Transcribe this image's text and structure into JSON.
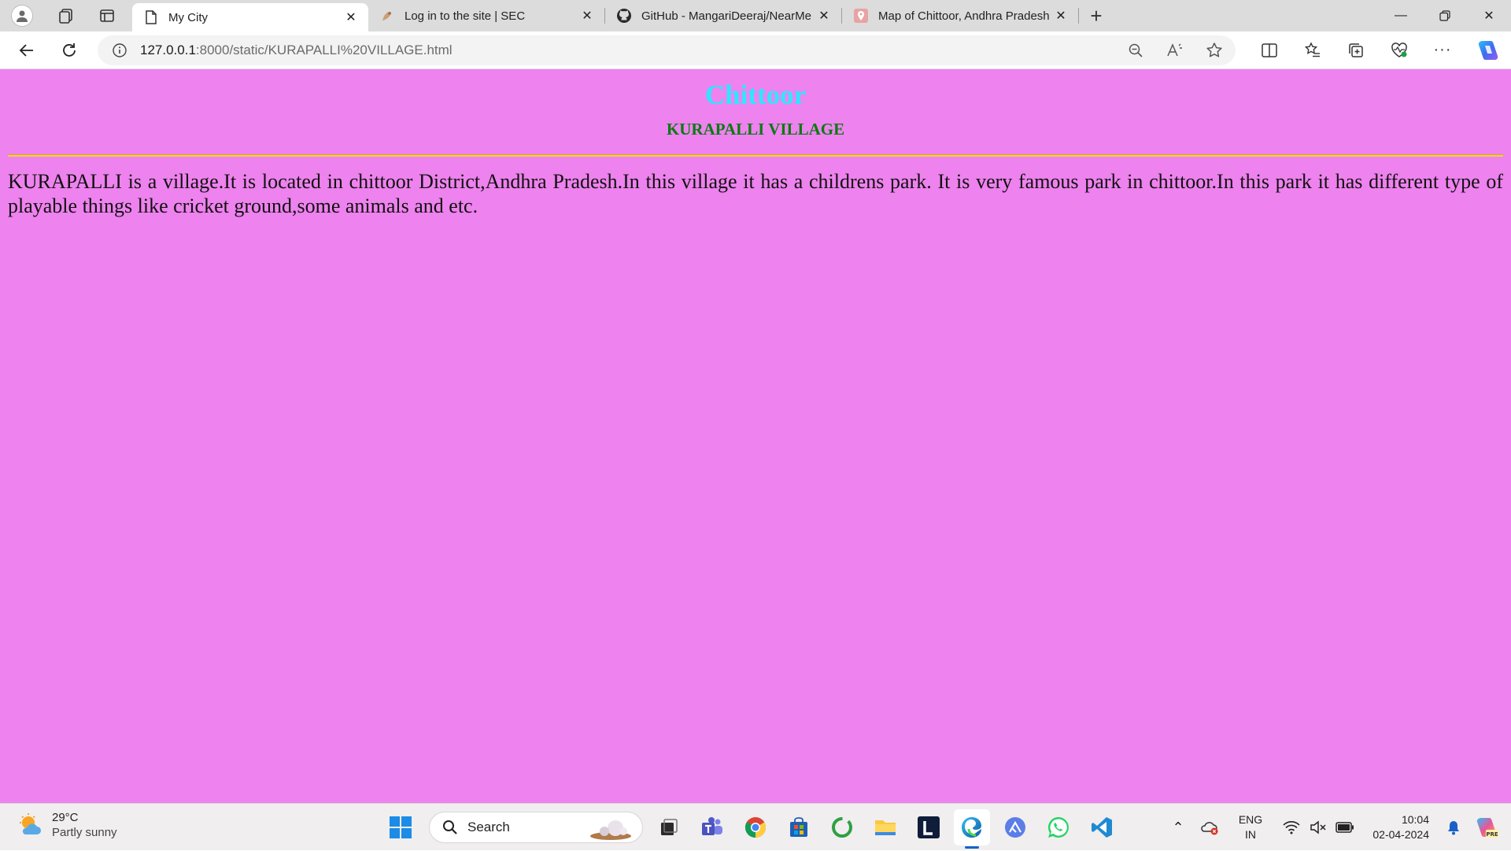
{
  "browser": {
    "tabs": [
      {
        "title": "My City",
        "favicon": "page-icon",
        "active": true
      },
      {
        "title": "Log in to the site | SEC",
        "favicon": "site-icon",
        "active": false
      },
      {
        "title": "GitHub - MangariDeeraj/NearMe",
        "favicon": "github-icon",
        "active": false
      },
      {
        "title": "Map of Chittoor, Andhra Pradesh",
        "favicon": "map-pin-icon",
        "active": false
      }
    ],
    "url_host": "127.0.0.1",
    "url_rest": ":8000/static/KURAPALLI%20VILLAGE.html"
  },
  "page": {
    "heading": "Chittoor",
    "subheading": "KURAPALLI VILLAGE",
    "paragraph": "KURAPALLI is a village.It is located in chittoor District,Andhra Pradesh.In this village it has a childrens park. It is very famous park in chittoor.In this park it has different type of playable things like cricket ground,some animals and etc.",
    "colors": {
      "background": "#ee82ee",
      "heading": "#2ee6ff",
      "subheading": "#0a7a12",
      "rule": "#f4cf3a"
    }
  },
  "taskbar": {
    "weather_temp": "29°C",
    "weather_desc": "Partly sunny",
    "search_label": "Search",
    "lang_line1": "ENG",
    "lang_line2": "IN",
    "time": "10:04",
    "date": "02-04-2024"
  }
}
